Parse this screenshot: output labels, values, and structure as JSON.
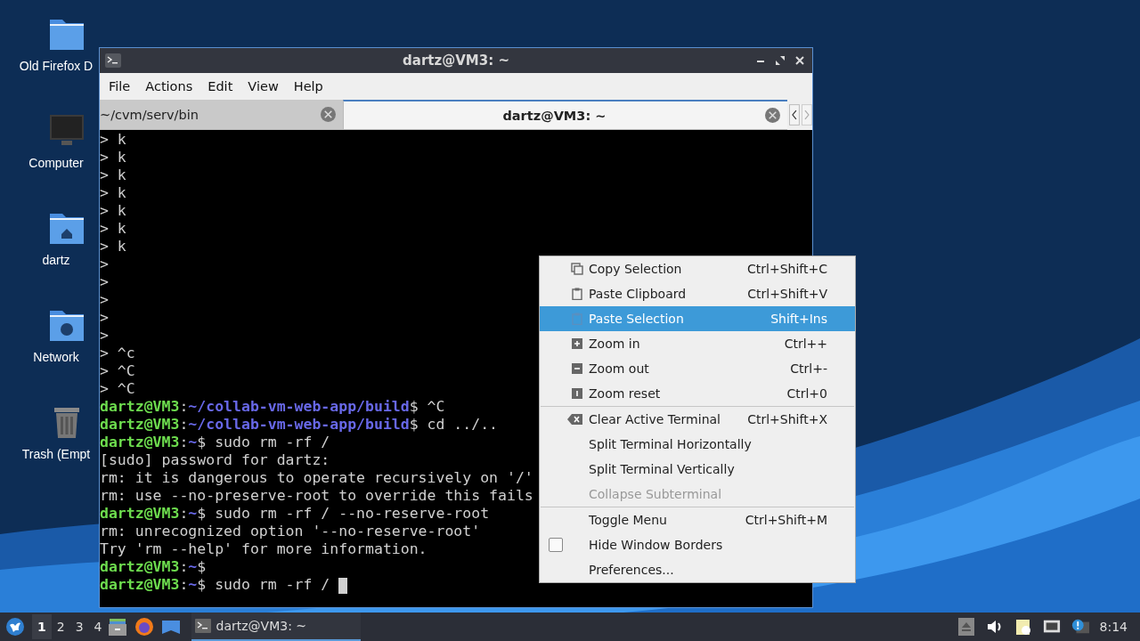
{
  "desktop_icons": [
    {
      "label": "Old Firefox D",
      "kind": "folder"
    },
    {
      "label": "Computer",
      "kind": "computer"
    },
    {
      "label": "dartz",
      "kind": "home"
    },
    {
      "label": "Network",
      "kind": "network"
    },
    {
      "label": "Trash (Empt",
      "kind": "trash"
    }
  ],
  "window": {
    "title": "dartz@VM3: ~",
    "menu": [
      "File",
      "Actions",
      "Edit",
      "View",
      "Help"
    ],
    "tabs": [
      {
        "label": "~/cvm/serv/bin",
        "selected": false
      },
      {
        "label": "dartz@VM3: ~",
        "selected": true
      }
    ],
    "terminal_lines": [
      [
        {
          "kind": "plain",
          "text": "> k"
        }
      ],
      [
        {
          "kind": "plain",
          "text": "> k"
        }
      ],
      [
        {
          "kind": "plain",
          "text": "> k"
        }
      ],
      [
        {
          "kind": "plain",
          "text": "> k"
        }
      ],
      [
        {
          "kind": "plain",
          "text": "> k"
        }
      ],
      [
        {
          "kind": "plain",
          "text": "> k"
        }
      ],
      [
        {
          "kind": "plain",
          "text": "> k"
        }
      ],
      [
        {
          "kind": "plain",
          "text": ">"
        }
      ],
      [
        {
          "kind": "plain",
          "text": ">"
        }
      ],
      [
        {
          "kind": "plain",
          "text": ">"
        }
      ],
      [
        {
          "kind": "plain",
          "text": ">"
        }
      ],
      [
        {
          "kind": "plain",
          "text": ">"
        }
      ],
      [
        {
          "kind": "plain",
          "text": "> ^c"
        }
      ],
      [
        {
          "kind": "plain",
          "text": "> ^C"
        }
      ],
      [
        {
          "kind": "plain",
          "text": "> ^C"
        }
      ],
      [
        {
          "kind": "user",
          "text": "dartz@VM3"
        },
        {
          "kind": "plain",
          "text": ":"
        },
        {
          "kind": "path",
          "text": "~/collab-vm-web-app/build"
        },
        {
          "kind": "plain",
          "text": "$ ^C"
        }
      ],
      [
        {
          "kind": "user",
          "text": "dartz@VM3"
        },
        {
          "kind": "plain",
          "text": ":"
        },
        {
          "kind": "path",
          "text": "~/collab-vm-web-app/build"
        },
        {
          "kind": "plain",
          "text": "$ cd ../.."
        }
      ],
      [
        {
          "kind": "user",
          "text": "dartz@VM3"
        },
        {
          "kind": "plain",
          "text": ":"
        },
        {
          "kind": "path",
          "text": "~"
        },
        {
          "kind": "plain",
          "text": "$ sudo rm -rf /"
        }
      ],
      [
        {
          "kind": "plain",
          "text": "[sudo] password for dartz:"
        }
      ],
      [
        {
          "kind": "plain",
          "text": "rm: it is dangerous to operate recursively on '/'"
        }
      ],
      [
        {
          "kind": "plain",
          "text": "rm: use --no-preserve-root to override this fails"
        }
      ],
      [
        {
          "kind": "user",
          "text": "dartz@VM3"
        },
        {
          "kind": "plain",
          "text": ":"
        },
        {
          "kind": "path",
          "text": "~"
        },
        {
          "kind": "plain",
          "text": "$ sudo rm -rf / --no-reserve-root"
        }
      ],
      [
        {
          "kind": "plain",
          "text": "rm: unrecognized option '--no-reserve-root'"
        }
      ],
      [
        {
          "kind": "plain",
          "text": "Try 'rm --help' for more information."
        }
      ],
      [
        {
          "kind": "user",
          "text": "dartz@VM3"
        },
        {
          "kind": "plain",
          "text": ":"
        },
        {
          "kind": "path",
          "text": "~"
        },
        {
          "kind": "plain",
          "text": "$"
        }
      ],
      [
        {
          "kind": "user",
          "text": "dartz@VM3"
        },
        {
          "kind": "plain",
          "text": ":"
        },
        {
          "kind": "path",
          "text": "~"
        },
        {
          "kind": "plain",
          "text": "$ sudo rm -rf / "
        },
        {
          "kind": "cursor"
        }
      ]
    ]
  },
  "context_menu": [
    {
      "kind": "action",
      "label": "Copy Selection",
      "shortcut": "Ctrl+Shift+C",
      "selected": false,
      "disabled": false
    },
    {
      "kind": "action",
      "label": "Paste Clipboard",
      "shortcut": "Ctrl+Shift+V",
      "selected": false,
      "disabled": false
    },
    {
      "kind": "action",
      "label": "Paste Selection",
      "shortcut": "Shift+Ins",
      "selected": true,
      "disabled": false
    },
    {
      "kind": "action",
      "label": "Zoom in",
      "shortcut": "Ctrl++",
      "selected": false,
      "disabled": false
    },
    {
      "kind": "action",
      "label": "Zoom out",
      "shortcut": "Ctrl+-",
      "selected": false,
      "disabled": false
    },
    {
      "kind": "action",
      "label": "Zoom reset",
      "shortcut": "Ctrl+0",
      "selected": false,
      "disabled": false
    },
    {
      "kind": "separator"
    },
    {
      "kind": "action",
      "label": "Clear Active Terminal",
      "shortcut": "Ctrl+Shift+X",
      "selected": false,
      "disabled": false
    },
    {
      "kind": "action",
      "label": "Split Terminal Horizontally",
      "selected": false,
      "disabled": false
    },
    {
      "kind": "action",
      "label": "Split Terminal Vertically",
      "selected": false,
      "disabled": false
    },
    {
      "kind": "action",
      "label": "Collapse Subterminal",
      "selected": false,
      "disabled": true
    },
    {
      "kind": "separator"
    },
    {
      "kind": "action",
      "label": "Toggle Menu",
      "shortcut": "Ctrl+Shift+M",
      "selected": false,
      "disabled": false
    },
    {
      "kind": "check",
      "label": "Hide Window Borders",
      "checked": false,
      "selected": false,
      "disabled": false
    },
    {
      "kind": "action",
      "label": "Preferences...",
      "selected": false,
      "disabled": false
    }
  ],
  "taskbar": {
    "workspaces": [
      {
        "label": "1",
        "selected": true
      },
      {
        "label": "2",
        "selected": false
      },
      {
        "label": "3",
        "selected": false
      },
      {
        "label": "4",
        "selected": false
      }
    ],
    "tasks": [
      {
        "label": "dartz@VM3: ~",
        "selected": true
      }
    ],
    "clock": "8:14"
  }
}
